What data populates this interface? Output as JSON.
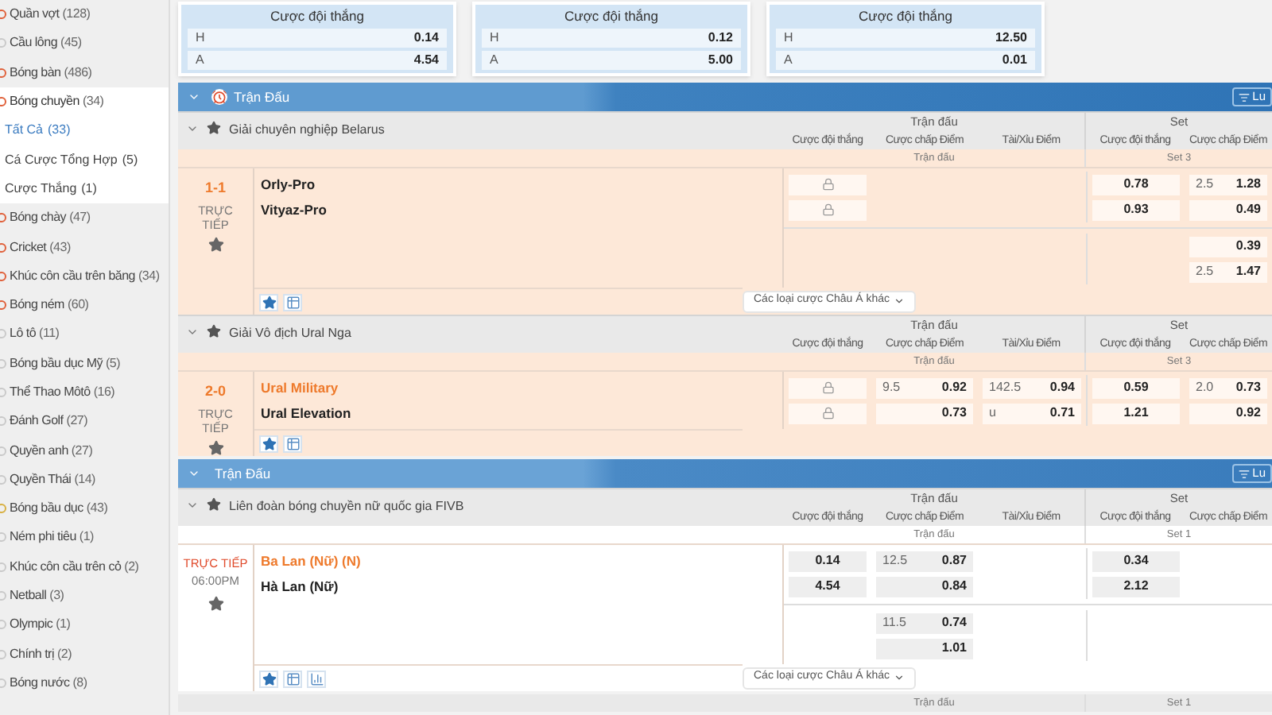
{
  "sidebar": {
    "items": [
      {
        "name": "Quần vợt",
        "count": "(128)",
        "selected": false,
        "color": "#e0603a"
      },
      {
        "name": "Cầu lông",
        "count": "(45)",
        "selected": false,
        "color": "#c9c9c9"
      },
      {
        "name": "Bóng bàn",
        "count": "(486)",
        "selected": false,
        "color": "#e0603a"
      },
      {
        "name": "Bóng chuyền",
        "count": "(34)",
        "selected": true,
        "color": "#e0603a",
        "children": [
          {
            "name": "Tất Cả",
            "count": "(33)",
            "selected": true
          },
          {
            "name": "Cá Cược Tổng Hợp",
            "count": "(5)",
            "selected": false
          },
          {
            "name": "Cược Thắng",
            "count": "(1)",
            "selected": false
          }
        ]
      },
      {
        "name": "Bóng chày",
        "count": "(47)",
        "selected": false,
        "color": "#e0603a"
      },
      {
        "name": "Cricket",
        "count": "(43)",
        "selected": false,
        "color": "#e0603a"
      },
      {
        "name": "Khúc côn cầu trên băng",
        "count": "(34)",
        "selected": false,
        "color": "#e0603a"
      },
      {
        "name": "Bóng ném",
        "count": "(60)",
        "selected": false,
        "color": "#e0603a"
      },
      {
        "name": "Lô tô",
        "count": "(11)",
        "selected": false,
        "color": "#c9c9c9"
      },
      {
        "name": "Bóng bầu dục Mỹ",
        "count": "(5)",
        "selected": false,
        "color": "#c9c9c9"
      },
      {
        "name": "Thể Thao Môtô",
        "count": "(16)",
        "selected": false,
        "color": "#c9c9c9"
      },
      {
        "name": "Đánh Golf",
        "count": "(27)",
        "selected": false,
        "color": "#c9c9c9"
      },
      {
        "name": "Quyền anh",
        "count": "(27)",
        "selected": false,
        "color": "#c9c9c9"
      },
      {
        "name": "Quyền Thái",
        "count": "(14)",
        "selected": false,
        "color": "#c9c9c9"
      },
      {
        "name": "Bóng bầu dục",
        "count": "(43)",
        "selected": false,
        "color": "#d8b040"
      },
      {
        "name": "Ném phi tiêu",
        "count": "(1)",
        "selected": false,
        "color": "#c9c9c9"
      },
      {
        "name": "Khúc côn cầu trên cỏ",
        "count": "(2)",
        "selected": false,
        "color": "#c9c9c9"
      },
      {
        "name": "Netball",
        "count": "(3)",
        "selected": false,
        "color": "#c9c9c9"
      },
      {
        "name": "Olympic",
        "count": "(1)",
        "selected": false,
        "color": "#c9c9c9"
      },
      {
        "name": "Chính trị",
        "count": "(2)",
        "selected": false,
        "color": "#c9c9c9"
      },
      {
        "name": "Bóng nước",
        "count": "(8)",
        "selected": false,
        "color": "#c9c9c9"
      }
    ]
  },
  "top_markets": [
    {
      "title": "Cược đội thắng",
      "rows": [
        {
          "label": "H",
          "value": "0.14"
        },
        {
          "label": "A",
          "value": "4.54"
        }
      ]
    },
    {
      "title": "Cược đội thắng",
      "rows": [
        {
          "label": "H",
          "value": "0.12"
        },
        {
          "label": "A",
          "value": "5.00"
        }
      ]
    },
    {
      "title": "Cược đội thắng",
      "rows": [
        {
          "label": "H",
          "value": "12.50"
        },
        {
          "label": "A",
          "value": "0.01"
        }
      ]
    }
  ],
  "sections": [
    {
      "title": "Trận Đấu",
      "live": true,
      "button": "Lu",
      "leagues": [
        {
          "name": "Giải chuyên nghiệp Belarus",
          "groups": [
            "Trận đấu",
            "Set"
          ],
          "columns": [
            "Cược đội thắng",
            "Cược chấp Điểm",
            "Tài/Xỉu Điểm",
            "Cược đội thắng",
            "Cược chấp Điểm"
          ],
          "subheads": [
            "Trận đấu",
            "Set 3"
          ],
          "matches": [
            {
              "kind": "score",
              "score": "1-1",
              "status": "TRỰC TIẾP",
              "teams": [
                {
                  "name": "Orly-Pro",
                  "highlighted": false
                },
                {
                  "name": "Vityaz-Pro",
                  "highlighted": false
                }
              ],
              "lines": [
                {
                  "win": {
                    "kind": "lock"
                  },
                  "set_win": {
                    "kind": "odds",
                    "price": "0.78"
                  },
                  "set_hcp": {
                    "kind": "odds",
                    "line": "2.5",
                    "price": "1.28"
                  }
                },
                {
                  "win": {
                    "kind": "lock"
                  },
                  "set_win": {
                    "kind": "odds",
                    "price": "0.93"
                  },
                  "set_hcp": {
                    "kind": "odds",
                    "price": "0.49"
                  }
                }
              ],
              "extra_lines": [
                {
                  "set_hcp": {
                    "kind": "odds",
                    "price": "0.39"
                  }
                },
                {
                  "set_hcp": {
                    "kind": "odds",
                    "line": "2.5",
                    "price": "1.47"
                  }
                }
              ],
              "tools": [
                {
                  "kind": "star"
                },
                {
                  "kind": "table"
                }
              ],
              "more": "Các loại cược Châu Á khác"
            }
          ]
        },
        {
          "name": "Giải Vô địch Ural Nga",
          "groups": [
            "Trận đấu",
            "Set"
          ],
          "columns": [
            "Cược đội thắng",
            "Cược chấp Điểm",
            "Tài/Xỉu Điểm",
            "Cược đội thắng",
            "Cược chấp Điểm"
          ],
          "subheads": [
            "Trận đấu",
            "Set 3"
          ],
          "matches": [
            {
              "kind": "score",
              "score": "2-0",
              "status": "TRỰC TIẾP",
              "teams": [
                {
                  "name": "Ural Military",
                  "highlighted": true
                },
                {
                  "name": "Ural Elevation",
                  "highlighted": false
                }
              ],
              "lines": [
                {
                  "win": {
                    "kind": "lock"
                  },
                  "hcp": {
                    "kind": "odds",
                    "line": "9.5",
                    "price": "0.92"
                  },
                  "ou": {
                    "kind": "odds",
                    "line": "142.5",
                    "price": "0.94"
                  },
                  "set_win": {
                    "kind": "odds",
                    "price": "0.59"
                  },
                  "set_hcp": {
                    "kind": "odds",
                    "line": "2.0",
                    "price": "0.73"
                  }
                },
                {
                  "win": {
                    "kind": "lock"
                  },
                  "hcp": {
                    "kind": "odds",
                    "price": "0.73"
                  },
                  "ou": {
                    "kind": "odds",
                    "line": "u",
                    "price": "0.71"
                  },
                  "set_win": {
                    "kind": "odds",
                    "price": "1.21"
                  },
                  "set_hcp": {
                    "kind": "odds",
                    "price": "0.92"
                  }
                }
              ],
              "tools": [
                {
                  "kind": "star"
                },
                {
                  "kind": "table"
                }
              ]
            }
          ]
        }
      ]
    },
    {
      "title": "Trận Đấu",
      "live": false,
      "button": "Lu",
      "leagues": [
        {
          "name": "Liên đoàn bóng chuyền nữ quốc gia FIVB",
          "groups": [
            "Trận đấu",
            "Set"
          ],
          "columns": [
            "Cược đội thắng",
            "Cược chấp Điểm",
            "Tài/Xỉu Điểm",
            "Cược đội thắng",
            "Cược chấp Điểm"
          ],
          "subheads": [
            "Trận đấu",
            "Set 1"
          ],
          "matches": [
            {
              "kind": "scheduled",
              "status": "TRỰC TIẾP",
              "time": "06:00PM",
              "teams": [
                {
                  "name": "Ba Lan (Nữ) (N)",
                  "highlighted": true
                },
                {
                  "name": "Hà Lan (Nữ)",
                  "highlighted": false
                }
              ],
              "lines": [
                {
                  "win": {
                    "kind": "odds",
                    "price": "0.14"
                  },
                  "hcp": {
                    "kind": "odds",
                    "line": "12.5",
                    "price": "0.87"
                  },
                  "set_win": {
                    "kind": "odds",
                    "price": "0.34"
                  }
                },
                {
                  "win": {
                    "kind": "odds",
                    "price": "4.54"
                  },
                  "hcp": {
                    "kind": "odds",
                    "price": "0.84"
                  },
                  "set_win": {
                    "kind": "odds",
                    "price": "2.12"
                  }
                }
              ],
              "extra_lines": [
                {
                  "hcp": {
                    "kind": "odds",
                    "line": "11.5",
                    "price": "0.74"
                  }
                },
                {
                  "hcp": {
                    "kind": "odds",
                    "price": "1.01"
                  }
                }
              ],
              "tools": [
                {
                  "kind": "star"
                },
                {
                  "kind": "table"
                },
                {
                  "kind": "chart"
                }
              ],
              "more": "Các loại cược Châu Á khác"
            }
          ]
        }
      ],
      "trailing_row": [
        "Trận đấu",
        "Set 1"
      ]
    }
  ]
}
